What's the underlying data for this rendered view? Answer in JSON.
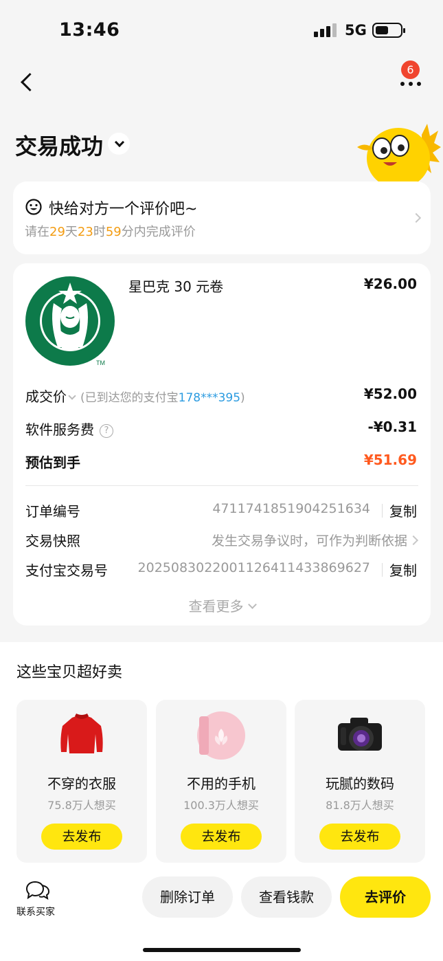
{
  "status_bar": {
    "time": "13:46",
    "network": "5G"
  },
  "nav": {
    "badge_count": "6"
  },
  "header": {
    "title": "交易成功"
  },
  "review_prompt": {
    "title": "快给对方一个评价吧~",
    "prefix": "请在",
    "days": "29",
    "days_unit": "天",
    "hours": "23",
    "hours_unit": "时",
    "minutes": "59",
    "suffix": "分内完成评价"
  },
  "product": {
    "name": "星巴克 30 元卷",
    "price": "¥26.00"
  },
  "price_rows": {
    "deal_label": "成交价",
    "paid_note_prefix": "(已到达您的支付宝",
    "paid_account": "178***395",
    "paid_note_suffix": ")",
    "deal_value": "¥52.00",
    "fee_label": "软件服务费",
    "fee_value": "-¥0.31",
    "net_label": "预估到手",
    "net_value": "¥51.69"
  },
  "order_info": {
    "order_no_label": "订单编号",
    "order_no": "4711741851904251634",
    "copy_label": "复制",
    "snapshot_label": "交易快照",
    "snapshot_desc": "发生交易争议时，可作为判断依据",
    "alipay_label": "支付宝交易号",
    "alipay_no": "2025083022001126411433869627",
    "see_more": "查看更多"
  },
  "recommendations": {
    "title": "这些宝贝超好卖",
    "items": [
      {
        "name": "不穿的衣服",
        "count": "75.8万人想买",
        "button": "去发布",
        "icon": "red-sweater-icon"
      },
      {
        "name": "不用的手机",
        "count": "100.3万人想买",
        "button": "去发布",
        "icon": "pink-phone-icon"
      },
      {
        "name": "玩腻的数码",
        "count": "81.8万人想买",
        "button": "去发布",
        "icon": "camera-icon"
      }
    ]
  },
  "bottom_bar": {
    "contact_label": "联系买家",
    "delete_label": "删除订单",
    "money_label": "查看钱款",
    "review_label": "去评价"
  },
  "colors": {
    "accent_yellow": "#ffe60f",
    "highlight_orange": "#f39c12",
    "price_red": "#ff5a1f",
    "link_blue": "#2b9be0",
    "starbucks_green": "#0d7a4a"
  }
}
